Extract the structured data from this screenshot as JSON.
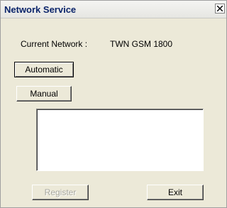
{
  "window": {
    "title": "Network Service"
  },
  "network": {
    "current_label": "Current Network :",
    "current_value": "TWN GSM 1800"
  },
  "buttons": {
    "automatic": "Automatic",
    "manual": "Manual",
    "register": "Register",
    "exit": "Exit"
  },
  "network_list": {
    "items": []
  },
  "colors": {
    "title_text": "#0a246a",
    "dialog_background": "#ece9d8"
  },
  "icons": {
    "close": "close-icon"
  }
}
